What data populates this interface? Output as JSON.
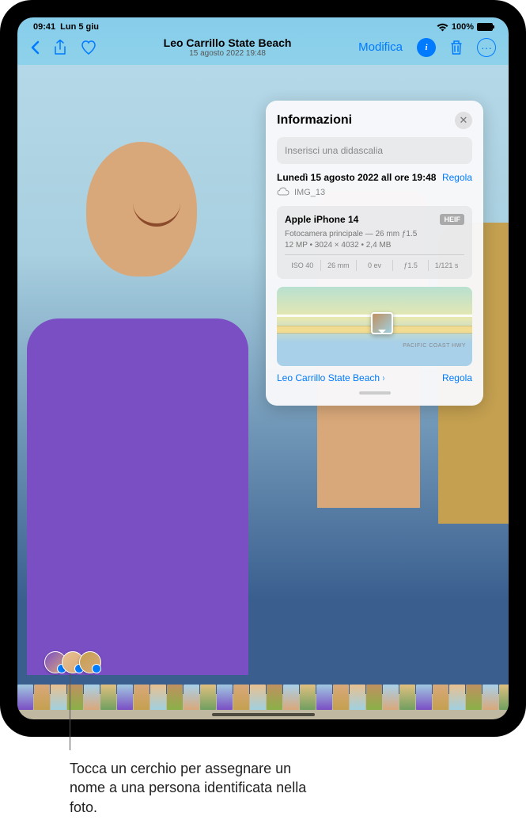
{
  "status": {
    "time": "09:41",
    "date": "Lun 5 giu",
    "battery": "100%"
  },
  "nav": {
    "title": "Leo Carrillo State Beach",
    "subtitle": "15 agosto 2022 19:48",
    "edit": "Modifica"
  },
  "panel": {
    "title": "Informazioni",
    "caption_placeholder": "Inserisci una didascalia",
    "date": "Lunedì 15 agosto 2022 all ore 19:48",
    "adjust": "Regola",
    "filename": "IMG_13",
    "device": "Apple iPhone 14",
    "format": "HEIF",
    "lens": "Fotocamera principale — 26 mm ƒ1.5",
    "specs": "12 MP • 3024 × 4032 • 2,4 MB",
    "exif": {
      "iso": "ISO 40",
      "focal": "26 mm",
      "ev": "0 ev",
      "aperture": "ƒ1.5",
      "shutter": "1/121 s"
    },
    "map_road": "PACIFIC COAST HWY",
    "location": "Leo Carrillo State Beach",
    "adjust2": "Regola"
  },
  "callout": "Tocca un cerchio per assegnare un nome a una persona identificata nella foto."
}
